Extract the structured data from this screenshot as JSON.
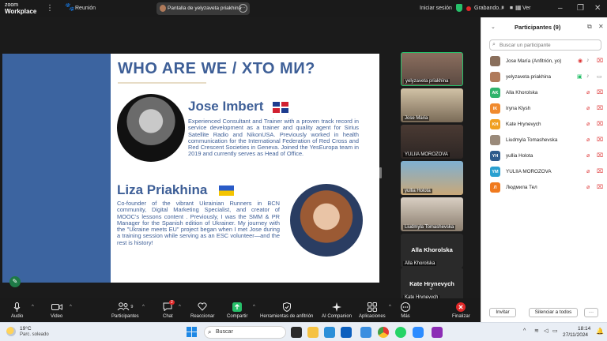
{
  "titlebar": {
    "logo_line1": "zoom",
    "logo_line2": "Workplace",
    "meeting_label": "Reunión",
    "share_label": "Pantalla de yelyzaveta priakhina",
    "signin": "Iniciar sesión",
    "recording": "Grabando...",
    "view": "Ver"
  },
  "slide": {
    "title": "WHO ARE WE / ХТО МИ?",
    "person1": {
      "name": "Jose Imbert",
      "bio": "Experienced Consultant and Trainer with a proven track record in service development as a trainer and quality agent for Sirius Satellite Radio and NikonUSA. Previously worked in health communication for the International Federation of Red Cross and Red Crescent Societies in Geneva. Joined the YesEuropa team in 2019 and currently serves as Head of Office."
    },
    "person2": {
      "name": "Liza Priakhina",
      "bio": "Co-founder of the vibrant Ukrainian Runners in BCN community, Digital Marketing Specialist, and creator of MOOC's lessons content . Previously, I was the SMM & PR Manager for the Spanish edition of Ukrainer. My journey with the \"Ukraine meets EU\" project began when I met Jose during a training session while serving as an ESC volunteer—and the rest is history!"
    }
  },
  "tiles": [
    {
      "name": "yelyzaveta priakhina"
    },
    {
      "name": "Jose Maria"
    },
    {
      "name": "YULIIA MOROZOVA"
    },
    {
      "name": "yullia Holota"
    },
    {
      "name": "Liudmyla Tomashevska"
    },
    {
      "name": "Alla Khorolska",
      "big": "Alla Khorolska"
    },
    {
      "name": "Kate Hrynevych",
      "big": "Kate Hrynevych"
    }
  ],
  "toolbar": {
    "audio": "Audio",
    "video": "Video",
    "participants": "Participantes",
    "participants_count": "9",
    "chat": "Chat",
    "chat_badge": "2",
    "react": "Reaccionar",
    "share": "Compartir",
    "host_tools": "Herramientas de anfitrión",
    "ai": "AI Companion",
    "apps": "Aplicaciones",
    "more": "Más",
    "end": "Finalizar"
  },
  "panel": {
    "title": "Participantes (9)",
    "search_placeholder": "Buscar un participante",
    "participants": [
      {
        "name": "Jose María (Anfitrión, yo)",
        "initials": "",
        "color": "#8a6f5c"
      },
      {
        "name": "yelyzaveta priakhina",
        "initials": "",
        "color": "#b07a5a"
      },
      {
        "name": "Alla Khorolska",
        "initials": "AK",
        "color": "#2fb36b"
      },
      {
        "name": "Iryna Klysh",
        "initials": "IK",
        "color": "#f08a2e"
      },
      {
        "name": "Kate Hrynevych",
        "initials": "KH",
        "color": "#f0a020"
      },
      {
        "name": "Liudmyla Tomashevska",
        "initials": "",
        "color": "#9a8a7a"
      },
      {
        "name": "yullia Holota",
        "initials": "YH",
        "color": "#2d5b8c"
      },
      {
        "name": "YULIIA MOROZOVA",
        "initials": "YM",
        "color": "#2aa0d0"
      },
      {
        "name": "Людмила Тел",
        "initials": "Л",
        "color": "#f07a1e"
      }
    ],
    "invite": "Invitar",
    "mute_all": "Silenciar a todos",
    "more": "···"
  },
  "taskbar": {
    "temp": "19°C",
    "condition": "Parc. soleado",
    "search": "Buscar",
    "time": "18:14",
    "date": "27/11/2024"
  },
  "colors": {
    "slide_blue": "#3c64a0",
    "accent_green": "#27c06a",
    "end_red": "#e02828"
  }
}
